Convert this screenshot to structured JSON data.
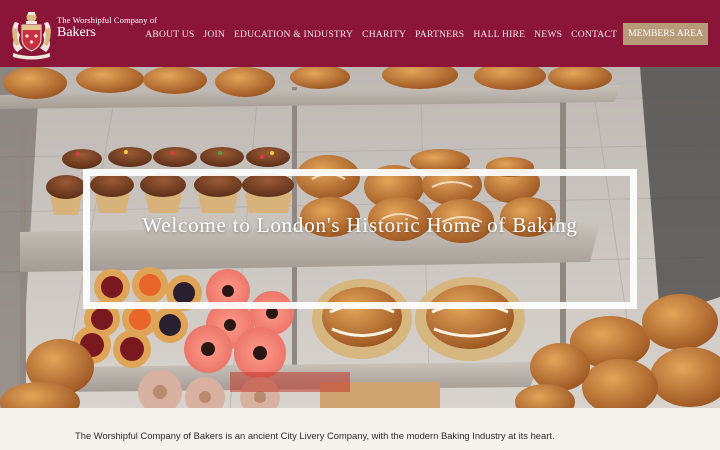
{
  "header": {
    "brand_top": "The Worshipful Company of",
    "brand_main": "Bakers",
    "crest_icon": "crest-logo",
    "colors": {
      "primary": "#8b1538",
      "members_button": "#b79a78"
    }
  },
  "nav": {
    "items": [
      {
        "label": "ABOUT US"
      },
      {
        "label": "JOIN"
      },
      {
        "label": "EDUCATION & INDUSTRY"
      },
      {
        "label": "CHARITY"
      },
      {
        "label": "PARTNERS"
      },
      {
        "label": "HALL HIRE"
      },
      {
        "label": "NEWS"
      },
      {
        "label": "CONTACT"
      }
    ],
    "members_label": "MEMBERS AREA"
  },
  "hero": {
    "title": "Welcome to London's Historic Home of Baking",
    "image": "bakery-display-photo"
  },
  "intro": {
    "text": "The Worshipful Company of Bakers is an ancient City Livery Company, with the modern Baking Industry at its heart."
  }
}
